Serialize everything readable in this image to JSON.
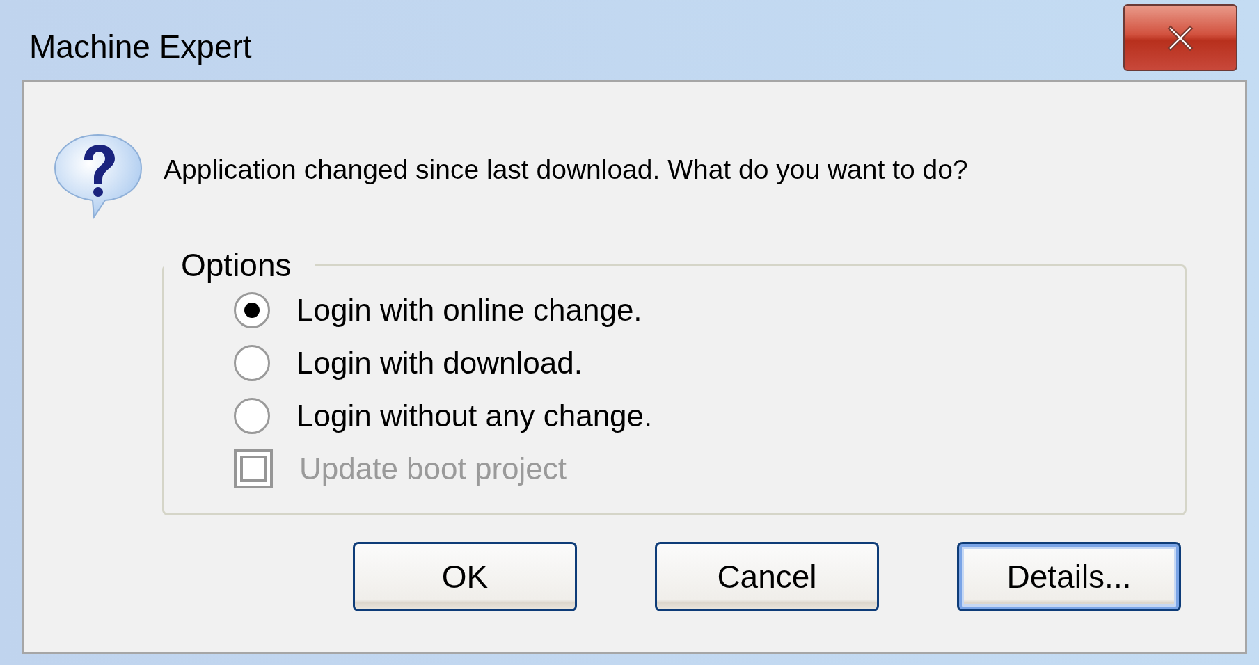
{
  "window": {
    "title": "Machine Expert"
  },
  "message": "Application changed since last download. What do you want to do?",
  "options": {
    "title": "Options",
    "choices": [
      {
        "label": "Login with online change.",
        "selected": true
      },
      {
        "label": "Login with download.",
        "selected": false
      },
      {
        "label": "Login without any change.",
        "selected": false
      }
    ],
    "checkbox": {
      "label": "Update boot project",
      "checked": false,
      "disabled": true
    }
  },
  "buttons": [
    {
      "label": "OK",
      "default": false
    },
    {
      "label": "Cancel",
      "default": false
    },
    {
      "label": "Details...",
      "default": true
    }
  ]
}
